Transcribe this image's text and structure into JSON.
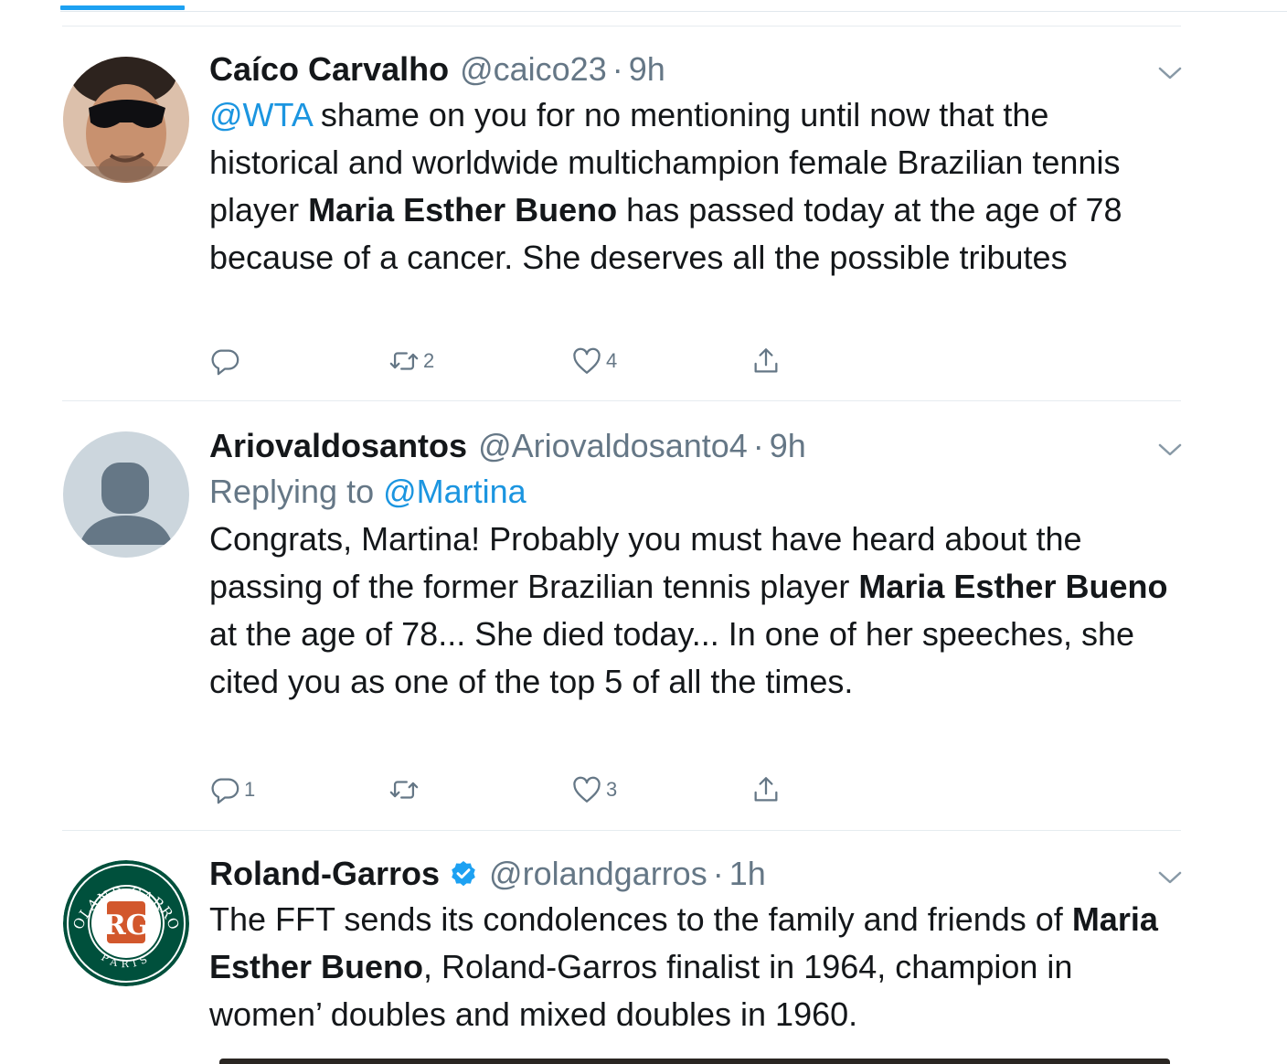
{
  "tweets": [
    {
      "display_name": "Caíco Carvalho",
      "handle": "@caico23",
      "separator": "·",
      "time": "9h",
      "mention": "@WTA",
      "text_part1": " shame on you for no mentioning until now that the historical and worldwide multichampion female Brazilian tennis player ",
      "bold_name": "Maria Esther Bueno",
      "text_part2": " has passed today at the age of 78 because of a cancer. She deserves all the possible tributes",
      "reply_count": "",
      "retweet_count": "2",
      "like_count": "4"
    },
    {
      "display_name": "Ariovaldosantos",
      "handle": "@Ariovaldosanto4",
      "separator": "·",
      "time": "9h",
      "replying_label": "Replying to ",
      "replying_to": "@Martina",
      "text_part1": "Congrats, Martina! Probably you must have heard about the passing of the former Brazilian tennis player ",
      "bold_name": "Maria Esther Bueno",
      "text_part2": " at the age of 78... She died today...  In one of her speeches, she cited you as one of the top 5 of all the times.",
      "reply_count": "1",
      "retweet_count": "",
      "like_count": "3"
    },
    {
      "display_name": "Roland-Garros",
      "handle": "@rolandgarros",
      "separator": "·",
      "time": "1h",
      "verified": true,
      "text_part1": "The FFT sends its condolences to the family and friends of ",
      "bold_name": "Maria Esther Bueno",
      "text_part2": ", Roland-Garros finalist in 1964, champion in women’ doubles and mixed doubles in 1960.",
      "logo_text": "ROLAND GARROS",
      "logo_sub": "PARIS",
      "logo_monogram": "RG"
    }
  ],
  "colors": {
    "link": "#1b95e0",
    "accent": "#1da1f2",
    "muted": "#657786",
    "rg_green": "#00503c",
    "rg_orange": "#d2572c"
  },
  "icons": {
    "reply": "reply-icon",
    "retweet": "retweet-icon",
    "like": "heart-icon",
    "share": "share-icon",
    "caret": "chevron-down-icon",
    "verified": "verified-badge-icon"
  }
}
